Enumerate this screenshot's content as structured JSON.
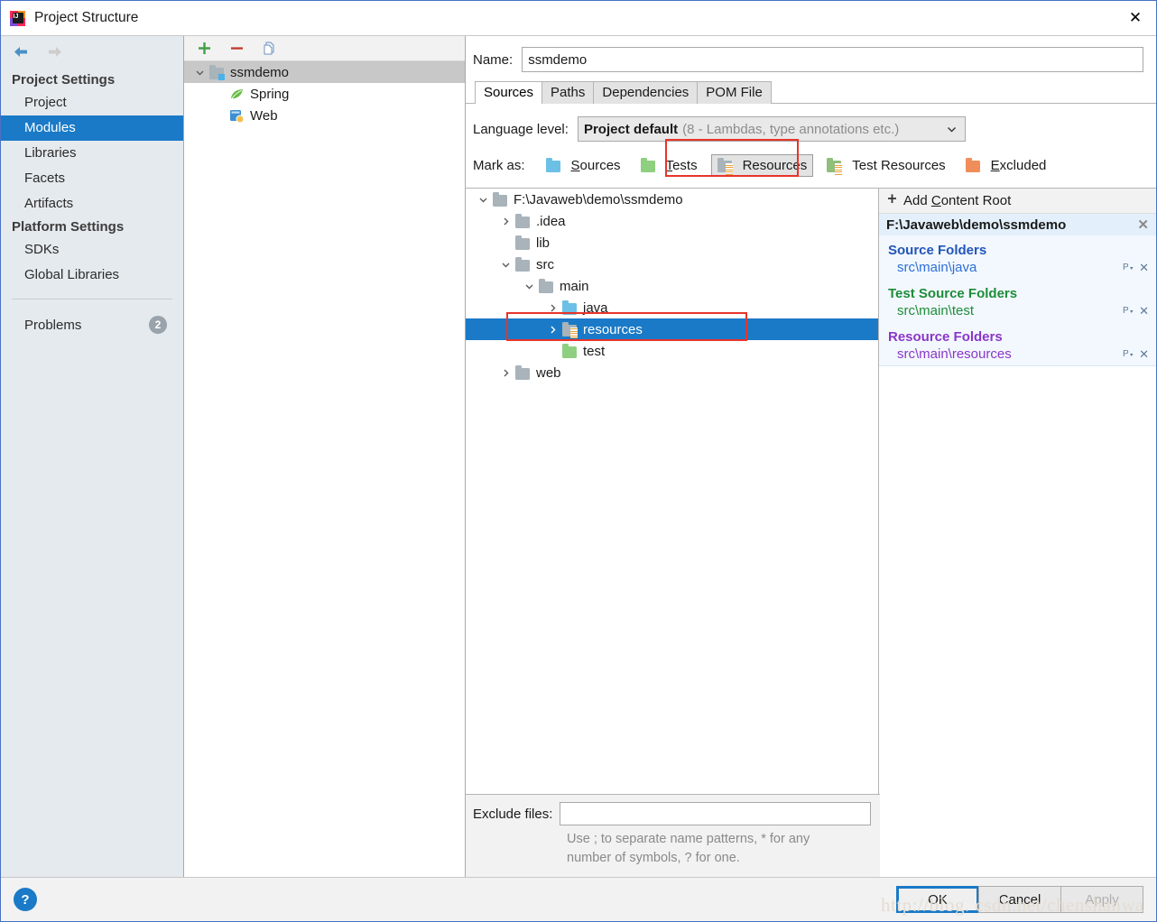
{
  "window": {
    "title": "Project Structure",
    "icon": "intellij-idea-icon",
    "close_label": "✕"
  },
  "sidebar": {
    "back_icon": "back-arrow-icon",
    "forward_icon": "forward-arrow-icon",
    "groups": [
      {
        "label": "Project Settings",
        "items": [
          {
            "label": "Project",
            "selected": false
          },
          {
            "label": "Modules",
            "selected": true
          },
          {
            "label": "Libraries",
            "selected": false
          },
          {
            "label": "Facets",
            "selected": false
          },
          {
            "label": "Artifacts",
            "selected": false
          }
        ]
      },
      {
        "label": "Platform Settings",
        "items": [
          {
            "label": "SDKs",
            "selected": false
          },
          {
            "label": "Global Libraries",
            "selected": false
          }
        ]
      }
    ],
    "problems": {
      "label": "Problems",
      "count": "2"
    }
  },
  "modules_panel": {
    "toolbar": {
      "add_label": "+",
      "remove_label": "−",
      "copy_label": "copy-icon"
    },
    "tree": [
      {
        "label": "ssmdemo",
        "icon": "module-folder-icon",
        "indent": 0,
        "expanded": true,
        "selected": true
      },
      {
        "label": "Spring",
        "icon": "spring-leaf-icon",
        "indent": 1,
        "expanded": null,
        "selected": false
      },
      {
        "label": "Web",
        "icon": "web-facet-icon",
        "indent": 1,
        "expanded": null,
        "selected": false
      }
    ]
  },
  "details": {
    "name_label": "Name:",
    "name_value": "ssmdemo",
    "tabs": [
      {
        "label": "Sources",
        "active": true
      },
      {
        "label": "Paths",
        "active": false
      },
      {
        "label": "Dependencies",
        "active": false
      },
      {
        "label": "POM File",
        "active": false
      }
    ],
    "language_level": {
      "label": "Language level:",
      "value": "Project default",
      "hint": "(8 - Lambdas, type annotations etc.)",
      "caret_icon": "chevron-down-icon"
    },
    "mark_as": {
      "label": "Mark as:",
      "buttons": [
        {
          "label": "Sources",
          "accel": "S",
          "icon": "sources-folder-icon",
          "pressed": false
        },
        {
          "label": "Tests",
          "accel": "T",
          "icon": "tests-folder-icon",
          "pressed": false
        },
        {
          "label": "Resources",
          "accel": "",
          "icon": "resources-folder-icon",
          "pressed": true
        },
        {
          "label": "Test Resources",
          "accel": "",
          "icon": "test-resources-folder-icon",
          "pressed": false
        },
        {
          "label": "Excluded",
          "accel": "E",
          "icon": "excluded-folder-icon",
          "pressed": false
        }
      ]
    },
    "file_tree": [
      {
        "label": "F:\\Javaweb\\demo\\ssmdemo",
        "indent": 0,
        "expander": "down",
        "icon": "folder-grey-icon",
        "selected": false
      },
      {
        "label": ".idea",
        "indent": 1,
        "expander": "right",
        "icon": "folder-grey-icon",
        "selected": false
      },
      {
        "label": "lib",
        "indent": 1,
        "expander": "none",
        "icon": "folder-grey-icon",
        "selected": false
      },
      {
        "label": "src",
        "indent": 1,
        "expander": "down",
        "icon": "folder-grey-icon",
        "selected": false
      },
      {
        "label": "main",
        "indent": 2,
        "expander": "down",
        "icon": "folder-grey-icon",
        "selected": false
      },
      {
        "label": "java",
        "indent": 3,
        "expander": "right",
        "icon": "folder-blue-icon",
        "selected": false
      },
      {
        "label": "resources",
        "indent": 3,
        "expander": "right",
        "icon": "resources-folder-icon",
        "selected": true
      },
      {
        "label": "test",
        "indent": 3,
        "expander": "none",
        "icon": "folder-green-icon",
        "selected": false
      },
      {
        "label": "web",
        "indent": 1,
        "expander": "right",
        "icon": "folder-grey-icon",
        "selected": false
      }
    ],
    "exclude": {
      "label": "Exclude files:",
      "value": "",
      "hint_line1": "Use ; to separate name patterns, * for any",
      "hint_line2": "number of symbols, ? for one."
    }
  },
  "content_roots": {
    "add_label": "Add Content Root",
    "add_icon": "plus-icon",
    "roots": [
      {
        "path": "F:\\Javaweb\\demo\\ssmdemo",
        "close_icon": "✕",
        "groups": [
          {
            "title": "Source Folders",
            "kind": "src",
            "entries": [
              {
                "path": "src\\main\\java",
                "props_icon": "properties-icon",
                "remove_icon": "✕"
              }
            ]
          },
          {
            "title": "Test Source Folders",
            "kind": "test",
            "entries": [
              {
                "path": "src\\main\\test",
                "props_icon": "properties-icon",
                "remove_icon": "✕"
              }
            ]
          },
          {
            "title": "Resource Folders",
            "kind": "res",
            "entries": [
              {
                "path": "src\\main\\resources",
                "props_icon": "properties-icon",
                "remove_icon": "✕"
              }
            ]
          }
        ]
      }
    ]
  },
  "footer": {
    "help_label": "?",
    "ok_label": "OK",
    "cancel_label": "Cancel",
    "apply_label": "Apply",
    "watermark": "http://blog. csdn.net/chenshanwa"
  },
  "colors": {
    "accent": "#1a7ac7",
    "highlight_box": "#e8342a",
    "sidebar_bg": "#e5eaee",
    "source_blue": "#2255bb",
    "test_green": "#1e8c3a",
    "resource_purple": "#8b36c9"
  }
}
